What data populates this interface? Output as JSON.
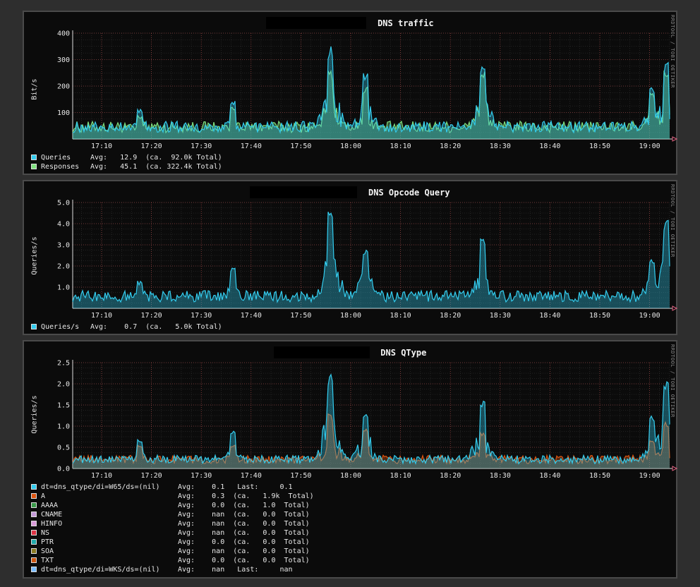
{
  "watermark": "RRDTOOL / TOBI OETIKER",
  "chart_data": [
    {
      "type": "area",
      "title": "DNS traffic",
      "ylabel": "Bit/s",
      "ylim": [
        0,
        400
      ],
      "yticks": [
        "400",
        "300",
        "200",
        "100"
      ],
      "xticks": [
        "17:10",
        "17:20",
        "17:30",
        "17:40",
        "17:50",
        "18:00",
        "18:10",
        "18:20",
        "18:30",
        "18:40",
        "18:50",
        "19:00"
      ],
      "series": [
        {
          "name": "Queries",
          "color": "#33ccee",
          "peaks": [
            [
              14.6,
              115
            ],
            [
              33.3,
              150
            ],
            [
              53.0,
              355
            ],
            [
              60.0,
              250
            ],
            [
              83.5,
              285
            ],
            [
              117.5,
              200
            ],
            [
              120.3,
              290
            ]
          ]
        },
        {
          "name": "Responses",
          "color": "#7fe07f",
          "peaks": [
            [
              14.6,
              90
            ],
            [
              33.3,
              120
            ],
            [
              53.0,
              260
            ],
            [
              60.0,
              200
            ],
            [
              83.5,
              260
            ],
            [
              117.5,
              180
            ],
            [
              120.3,
              260
            ]
          ]
        }
      ],
      "legend": [
        {
          "name": "Queries",
          "color": "#33ccee",
          "stats": "Avg:   12.9  (ca.  92.0k Total)"
        },
        {
          "name": "Responses",
          "color": "#7fe07f",
          "stats": "Avg:   45.1  (ca. 322.4k Total)"
        }
      ]
    },
    {
      "type": "area",
      "title": "DNS Opcode Query",
      "ylabel": "Queries/s",
      "ylim": [
        0,
        5
      ],
      "yticks": [
        "5.0",
        "4.0",
        "3.0",
        "2.0",
        "1.0"
      ],
      "xticks": [
        "17:10",
        "17:20",
        "17:30",
        "17:40",
        "17:50",
        "18:00",
        "18:10",
        "18:20",
        "18:30",
        "18:40",
        "18:50",
        "19:00"
      ],
      "series": [
        {
          "name": "Queries/s",
          "color": "#33ccee",
          "peaks": [
            [
              14.6,
              1.3
            ],
            [
              33.3,
              1.9
            ],
            [
              53.0,
              4.6
            ],
            [
              60.0,
              2.9
            ],
            [
              83.5,
              3.3
            ],
            [
              117.5,
              2.5
            ],
            [
              120.3,
              4.2
            ]
          ]
        }
      ],
      "legend": [
        {
          "name": "Queries/s",
          "color": "#33ccee",
          "stats": "Avg:    0.7  (ca.   5.0k Total)"
        }
      ]
    },
    {
      "type": "area",
      "title": "DNS QType",
      "ylabel": "Queries/s",
      "ylim": [
        0,
        2.5
      ],
      "yticks": [
        "2.5",
        "2.0",
        "1.5",
        "1.0",
        "0.5",
        "0.0"
      ],
      "xticks": [
        "17:10",
        "17:20",
        "17:30",
        "17:40",
        "17:50",
        "18:00",
        "18:10",
        "18:20",
        "18:30",
        "18:40",
        "18:50",
        "19:00"
      ],
      "series": [
        {
          "name": "dt=dns_qtype/di=W65/ds=(nil)",
          "color": "#33ccee",
          "peaks": [
            [
              14.6,
              0.7
            ],
            [
              33.3,
              0.9
            ],
            [
              53.0,
              2.3
            ],
            [
              60.0,
              1.4
            ],
            [
              83.5,
              1.65
            ],
            [
              117.5,
              1.3
            ],
            [
              120.3,
              2.1
            ]
          ]
        },
        {
          "name": "A",
          "color": "#dd5511",
          "peaks": [
            [
              14.6,
              0.55
            ],
            [
              33.3,
              0.6
            ],
            [
              53.0,
              1.3
            ],
            [
              60.0,
              1.0
            ],
            [
              83.5,
              0.9
            ],
            [
              117.5,
              0.7
            ],
            [
              120.3,
              1.1
            ]
          ]
        }
      ],
      "legend": [
        {
          "name": "dt=dns_qtype/di=W65/ds=(nil)",
          "color": "#33ccee",
          "stats": "Avg:    0.1   Last:     0.1"
        },
        {
          "name": "A",
          "color": "#dd5511",
          "stats": "Avg:    0.3  (ca.   1.9k  Total)"
        },
        {
          "name": "AAAA",
          "color": "#3a9a4a",
          "stats": "Avg:    0.0  (ca.   1.0  Total)"
        },
        {
          "name": "CNAME",
          "color": "#c49ad8",
          "stats": "Avg:    nan  (ca.   0.0  Total)"
        },
        {
          "name": "HINFO",
          "color": "#d89ad8",
          "stats": "Avg:    nan  (ca.   0.0  Total)"
        },
        {
          "name": "NS",
          "color": "#dd3344",
          "stats": "Avg:    nan  (ca.   0.0  Total)"
        },
        {
          "name": "PTR",
          "color": "#22aaaa",
          "stats": "Avg:    0.0  (ca.   0.0  Total)"
        },
        {
          "name": "SOA",
          "color": "#8a7a22",
          "stats": "Avg:    nan  (ca.   0.0  Total)"
        },
        {
          "name": "TXT",
          "color": "#cc5511",
          "stats": "Avg:    0.0  (ca.   0.0  Total)"
        },
        {
          "name": "dt=dns_qtype/di=WKS/ds=(nil)",
          "color": "#77bbff",
          "stats": "Avg:    nan   Last:     nan"
        }
      ]
    }
  ]
}
